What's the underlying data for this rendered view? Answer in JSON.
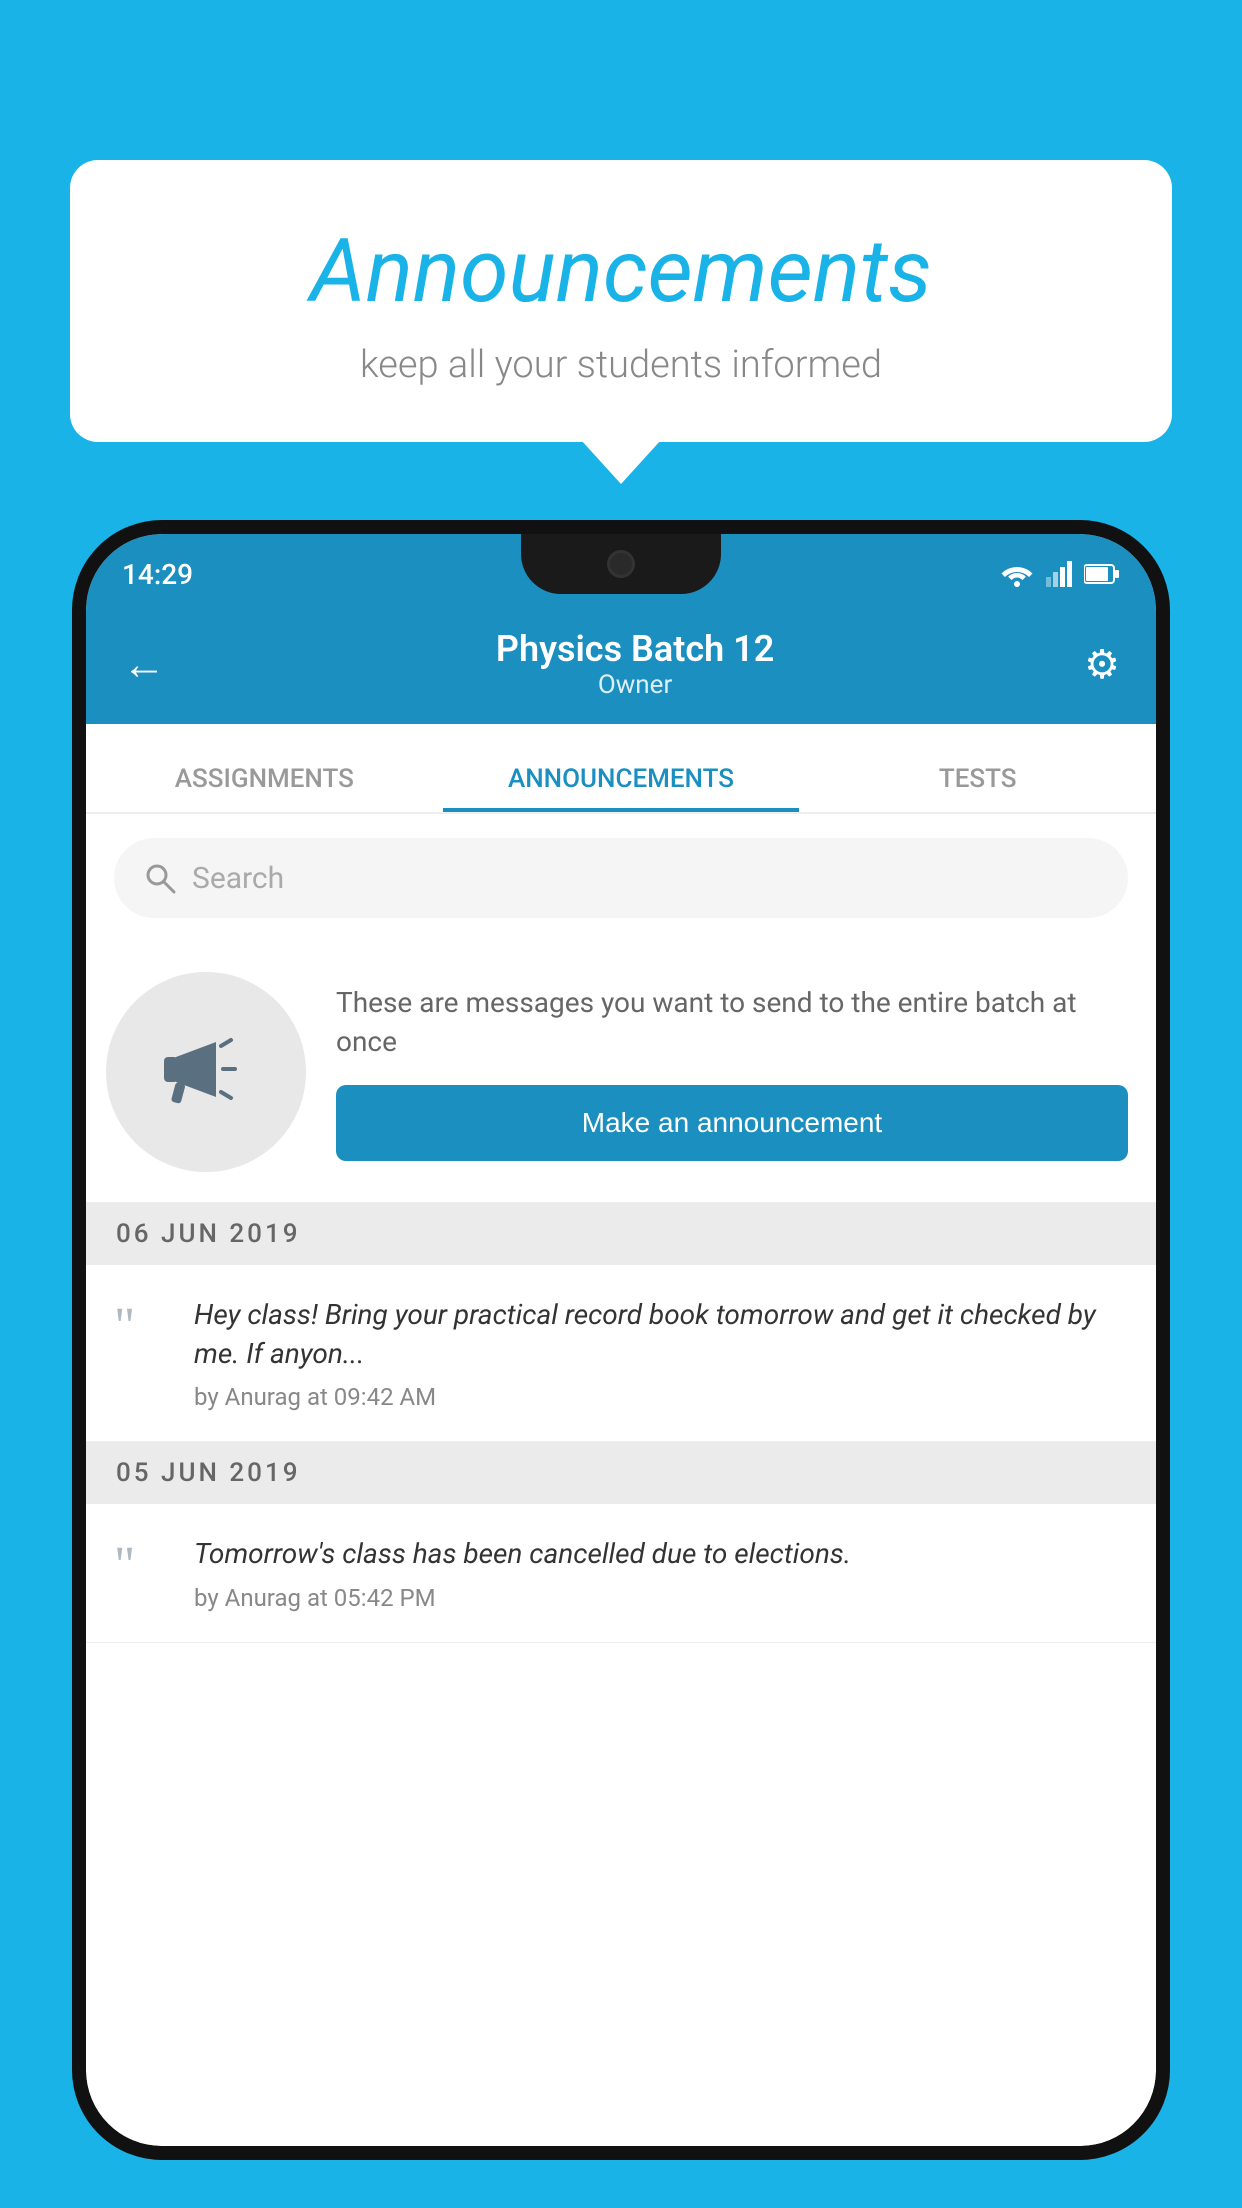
{
  "background_color": "#1ab3e8",
  "speech_bubble": {
    "title": "Announcements",
    "subtitle": "keep all your students informed"
  },
  "phone": {
    "status_bar": {
      "time": "14:29"
    },
    "app_bar": {
      "title": "Physics Batch 12",
      "subtitle": "Owner",
      "back_label": "←",
      "settings_label": "⚙"
    },
    "tabs": [
      {
        "label": "ASSIGNMENTS",
        "active": false
      },
      {
        "label": "ANNOUNCEMENTS",
        "active": true
      },
      {
        "label": "TESTS",
        "active": false
      }
    ],
    "search": {
      "placeholder": "Search"
    },
    "promo": {
      "description": "These are messages you want to send to the entire batch at once",
      "button_label": "Make an announcement"
    },
    "announcements": [
      {
        "date": "06  JUN  2019",
        "text": "Hey class! Bring your practical record book tomorrow and get it checked by me. If anyon...",
        "meta": "by Anurag at 09:42 AM"
      },
      {
        "date": "05  JUN  2019",
        "text": "Tomorrow's class has been cancelled due to elections.",
        "meta": "by Anurag at 05:42 PM"
      }
    ]
  }
}
